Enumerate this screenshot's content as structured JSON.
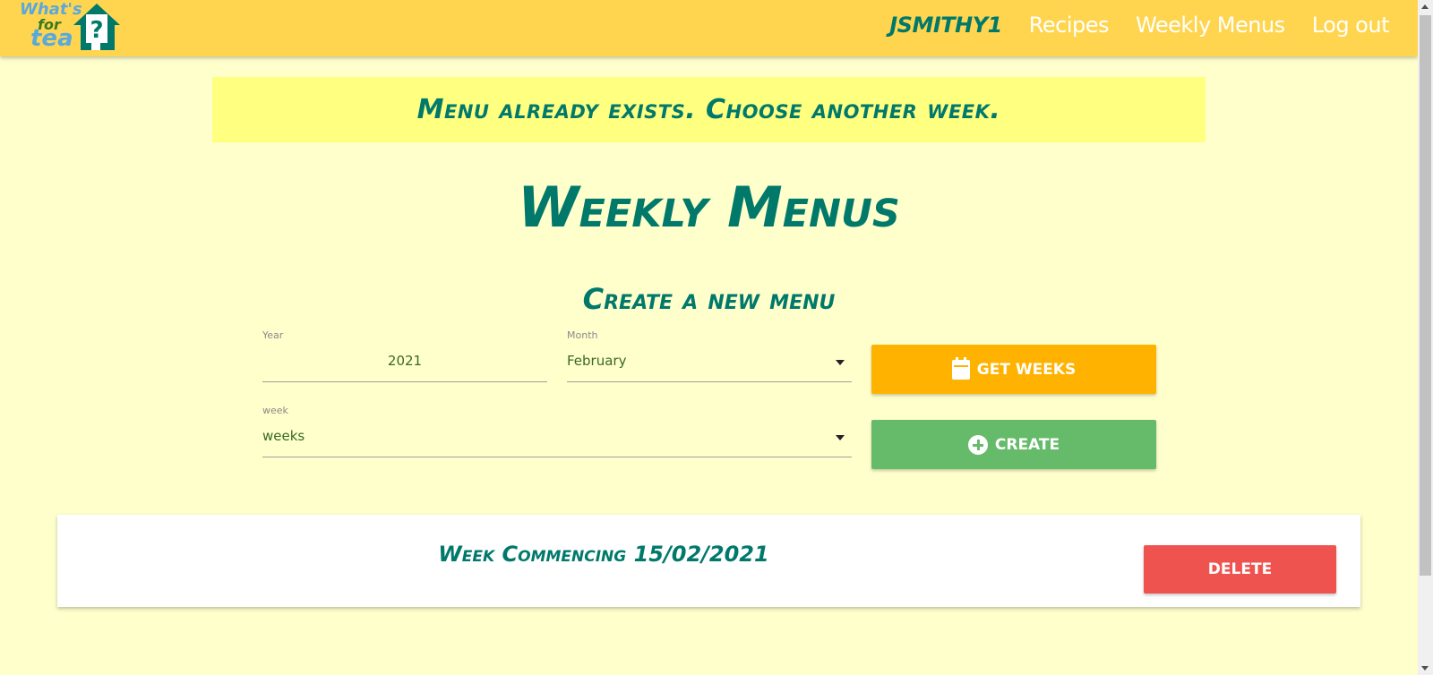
{
  "navbar": {
    "logo": {
      "line1": "What's",
      "line2": "for",
      "line3": "tea"
    },
    "links": {
      "user": "JSMITHY1",
      "recipes": "Recipes",
      "weekly_menus": "Weekly Menus",
      "logout": "Log out"
    },
    "colors": {
      "background": "#ffd54f",
      "user": "#00796b"
    }
  },
  "alert": {
    "message": "Menu already exists. Choose another week.",
    "background": "#ffff80"
  },
  "page": {
    "title": "Weekly Menus",
    "section_title": "Create a new menu",
    "background": "#ffffcc"
  },
  "form": {
    "year": {
      "label": "Year",
      "value": "2021"
    },
    "month": {
      "label": "Month",
      "value": "February"
    },
    "week": {
      "label": "week",
      "value": "weeks"
    },
    "get_weeks_button": {
      "label": "get weeks",
      "icon": "calendar-icon",
      "color": "#ffb300"
    },
    "create_button": {
      "label": "create",
      "icon": "plus-circle-icon",
      "color": "#66bb6a"
    }
  },
  "menus": [
    {
      "title": "Week Commencing 15/02/2021",
      "delete_label": "Delete",
      "delete_color": "#ef5350"
    }
  ]
}
